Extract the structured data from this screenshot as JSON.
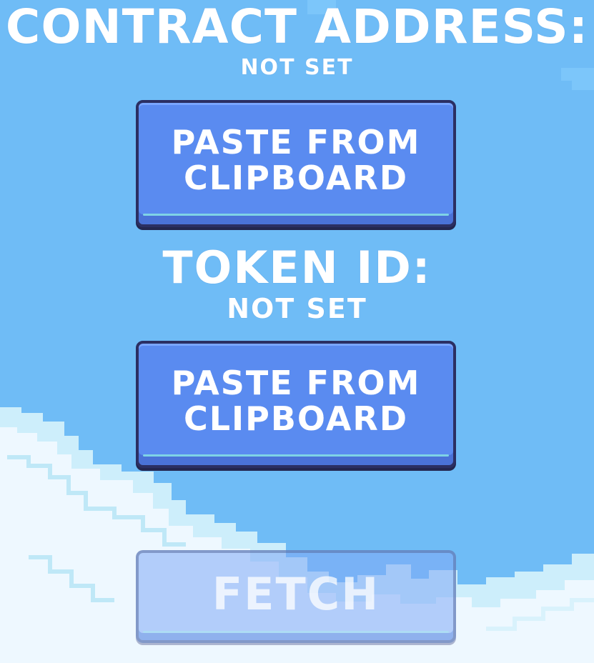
{
  "contract": {
    "heading": "CONTRACT ADDRESS:",
    "value": "NOT SET",
    "button_label": "PASTE FROM\nCLIPBOARD"
  },
  "token": {
    "heading": "TOKEN ID:",
    "value": "NOT SET",
    "button_label": "PASTE FROM\nCLIPBOARD"
  },
  "fetch": {
    "label": "FETCH",
    "enabled": false
  },
  "colors": {
    "sky": "#6fbcf6",
    "button": "#5a8bf0",
    "button_border": "#2b2f63",
    "cloud": "#eef8ff"
  },
  "icons": {
    "background": "pixel-cloud-sky"
  }
}
